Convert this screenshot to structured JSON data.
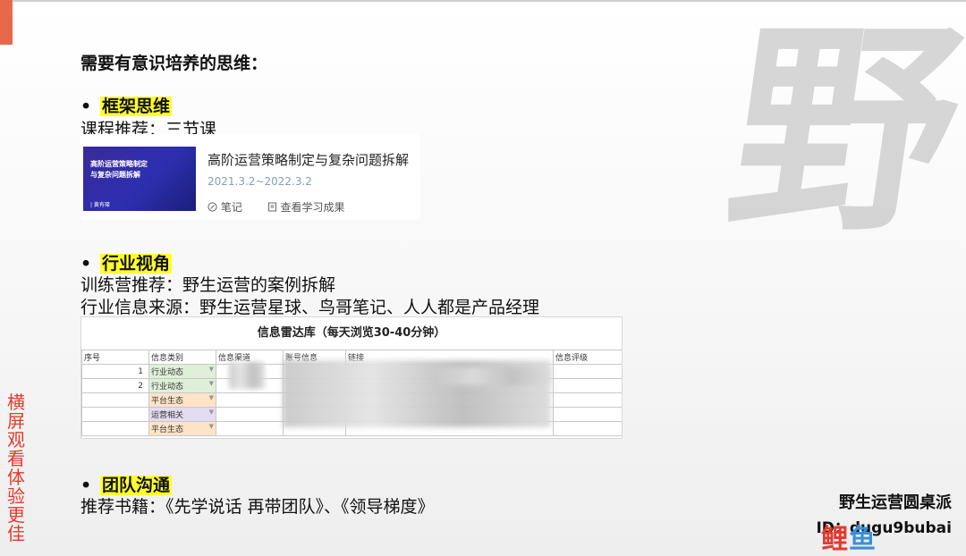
{
  "heading": "需要有意识培养的思维：",
  "watermark_char": "野",
  "sections": [
    {
      "bullet": "•",
      "title": "框架思维",
      "lines": [
        "课程推荐：三节课"
      ]
    },
    {
      "bullet": "•",
      "title": "行业视角",
      "lines": [
        "训练营推荐：野生运营的案例拆解",
        "行业信息来源：野生运营星球、鸟哥笔记、人人都是产品经理"
      ]
    },
    {
      "bullet": "•",
      "title": "团队沟通",
      "lines": [
        "推荐书籍：《先学说话 再带团队》、《领导梯度》"
      ]
    }
  ],
  "course_card": {
    "thumb_line1": "高阶运营策略制定",
    "thumb_line2": "与复杂问题拆解",
    "thumb_footer": "| 黄有璨",
    "title": "高阶运营策略制定与复杂问题拆解",
    "date_range": "2021.3.2~2022.3.2",
    "note_icon": "note-icon",
    "note_label": "笔记",
    "result_icon": "document-icon",
    "result_label": "查看学习成果"
  },
  "info_table": {
    "title": "信息雷达库（每天浏览30-40分钟）",
    "headers": [
      "序号",
      "信息类别",
      "信息渠道",
      "账号信息",
      "链接",
      "信息评级"
    ],
    "rows": [
      {
        "index": "1",
        "category": "行业动态",
        "color": "green"
      },
      {
        "index": "2",
        "category": "行业动态",
        "color": "green"
      },
      {
        "index": "",
        "category": "平台生态",
        "color": "orange"
      },
      {
        "index": "",
        "category": "运营相关",
        "color": "purple"
      },
      {
        "index": "",
        "category": "平台生态",
        "color": "orange"
      }
    ]
  },
  "sidebar_text": "横屏观看体验更佳",
  "brand": {
    "name": "野生运营圆桌派",
    "id": "ID：dugu9bubai",
    "logo_text_red": "鲤",
    "logo_text_blue": "鱼"
  },
  "colors": {
    "accent": "#e8694a",
    "highlight": "#ffff2e",
    "sidebar_red": "#e23b2e"
  }
}
